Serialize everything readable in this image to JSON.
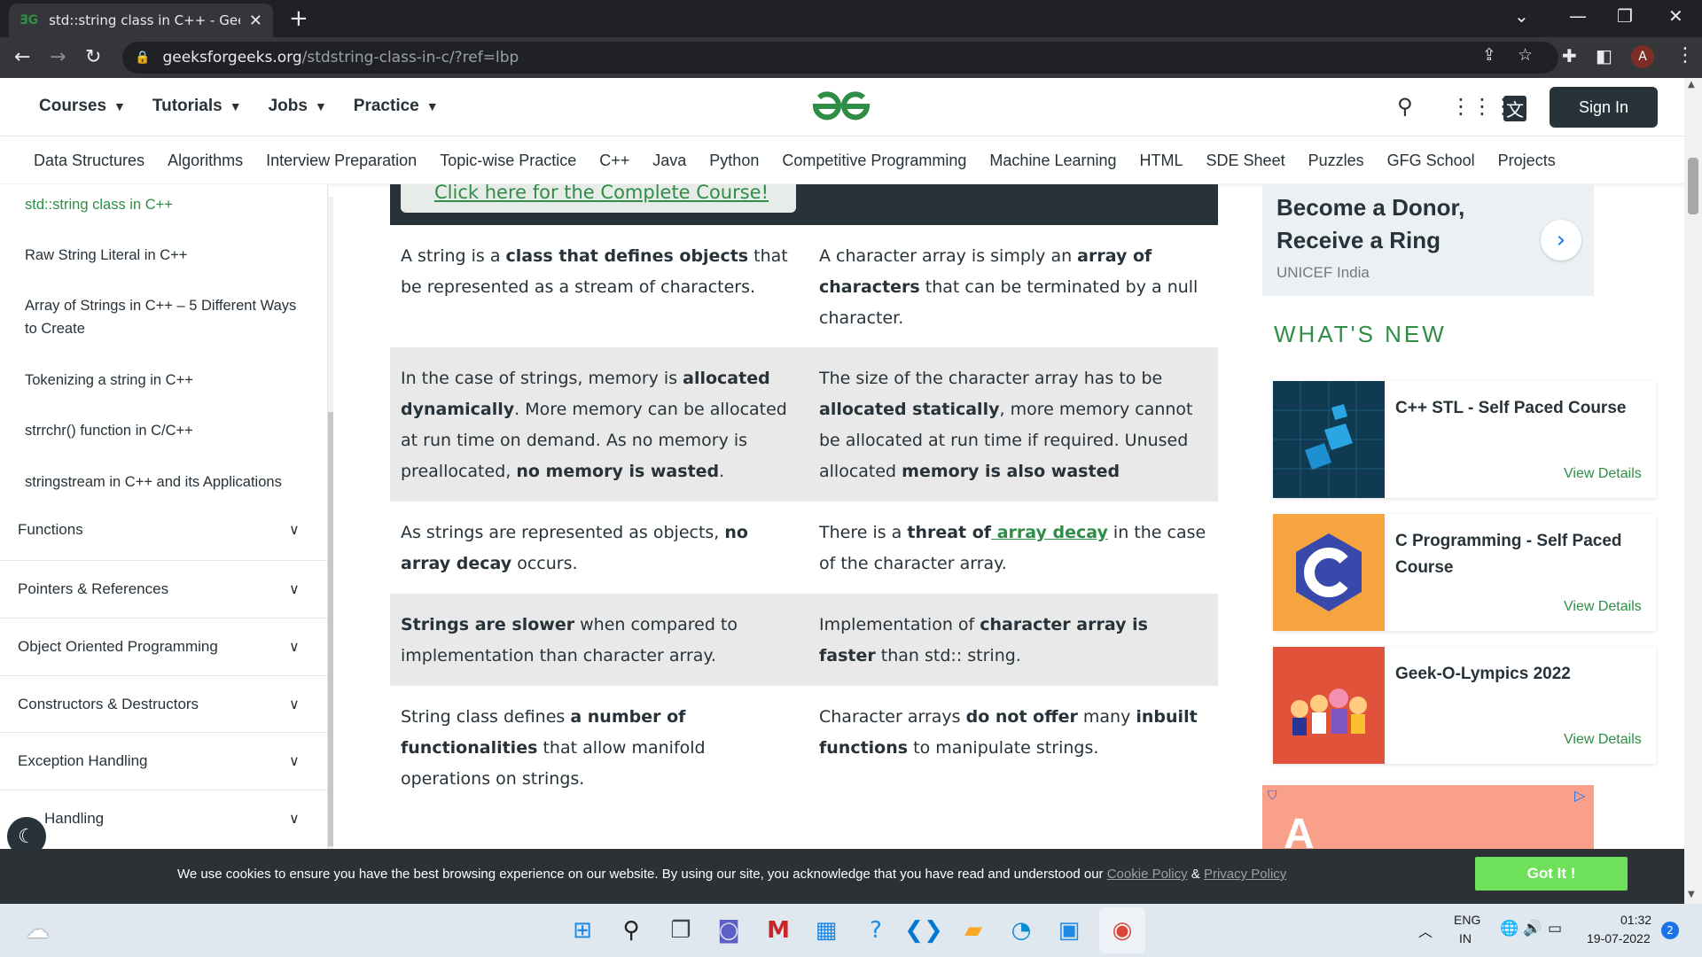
{
  "browser": {
    "tab_title": "std::string class in C++ - GeeksforGeeks",
    "url_host": "geeksforgeeks.org",
    "url_path": "/stdstring-class-in-c/?ref=lbp",
    "avatar_letter": "A"
  },
  "header": {
    "nav": [
      "Courses",
      "Tutorials",
      "Jobs",
      "Practice"
    ],
    "sign_in": "Sign In"
  },
  "subnav": [
    "Data Structures",
    "Algorithms",
    "Interview Preparation",
    "Topic-wise Practice",
    "C++",
    "Java",
    "Python",
    "Competitive Programming",
    "Machine Learning",
    "HTML",
    "SDE Sheet",
    "Puzzles",
    "GFG School",
    "Projects"
  ],
  "sidebar": {
    "links": [
      "std::string class in C++",
      "Raw String Literal in C++",
      "Array of Strings in C++ – 5 Different Ways to Create",
      "Tokenizing a string in C++",
      "strrchr() function in C/C++",
      "stringstream in C++ and its Applications"
    ],
    "sections": [
      "Functions",
      "Pointers & References",
      "Object Oriented Programming",
      "Constructors & Destructors",
      "Exception Handling",
      "Handling"
    ]
  },
  "main": {
    "banner_link": "Click here for the Complete Course!",
    "rows": [
      {
        "left": [
          {
            "t": " A string is a "
          },
          {
            "t": "class that defines objects",
            "b": true
          },
          {
            "t": " that be represented as a stream of characters."
          }
        ],
        "right": [
          {
            "t": "A character array is simply an "
          },
          {
            "t": "array of characters",
            "b": true
          },
          {
            "t": " that can be terminated by a null character."
          }
        ]
      },
      {
        "left": [
          {
            "t": "In the case of strings, memory is "
          },
          {
            "t": "allocated dynamically",
            "b": true
          },
          {
            "t": ". More memory can be allocated at run time on demand. As no memory is preallocated, "
          },
          {
            "t": "no memory is wasted",
            "b": true
          },
          {
            "t": "."
          }
        ],
        "right": [
          {
            "t": "The size of the character array has to be "
          },
          {
            "t": "allocated statically",
            "b": true
          },
          {
            "t": ", more memory cannot be allocated at run time if required. Unused allocated "
          },
          {
            "t": "memory is also wasted",
            "b": true
          }
        ]
      },
      {
        "left": [
          {
            "t": "As strings are represented as objects, "
          },
          {
            "t": "no array decay",
            "b": true
          },
          {
            "t": " occurs."
          }
        ],
        "right": [
          {
            "t": "There is a "
          },
          {
            "t": "threat of",
            "b": true
          },
          {
            "t": " array decay",
            "l": true
          },
          {
            "t": " in the case of the character array."
          }
        ]
      },
      {
        "left": [
          {
            "t": "Strings are slower",
            "b": true
          },
          {
            "t": " when compared to implementation than character array."
          }
        ],
        "right": [
          {
            "t": "Implementation of "
          },
          {
            "t": "character array is faster",
            "b": true
          },
          {
            "t": " than std:: string."
          }
        ]
      },
      {
        "left": [
          {
            "t": "String class defines "
          },
          {
            "t": "a number of functionalities",
            "b": true
          },
          {
            "t": " that allow manifold operations on strings."
          }
        ],
        "right": [
          {
            "t": "Character arrays "
          },
          {
            "t": "do not offer",
            "b": true
          },
          {
            "t": " many "
          },
          {
            "t": "inbuilt functions",
            "b": true
          },
          {
            "t": " to manipulate strings."
          }
        ]
      }
    ]
  },
  "right": {
    "donor_title": "Become a Donor, Receive a Ring",
    "donor_sub": "UNICEF India",
    "whats_new": "WHAT'S NEW",
    "courses": [
      {
        "title": "C++ STL - Self Paced Course",
        "view": "View Details"
      },
      {
        "title": "C Programming - Self Paced Course",
        "view": "View Details"
      },
      {
        "title": "Geek-O-Lympics 2022",
        "view": "View Details"
      }
    ]
  },
  "cookie": {
    "text": "We use cookies to ensure you have the best browsing experience on our website. By using our site, you acknowledge that you have read and understood our ",
    "cookie_policy": "Cookie Policy",
    "amp": " & ",
    "privacy_policy": "Privacy Policy",
    "button": "Got It !"
  },
  "taskbar": {
    "lang1": "ENG",
    "lang2": "IN",
    "time": "01:32",
    "date": "19-07-2022",
    "notifications": "2"
  },
  "colors": {
    "brand_green": "#2f8d46",
    "dark": "#273239",
    "got_it": "#6ee05a"
  }
}
